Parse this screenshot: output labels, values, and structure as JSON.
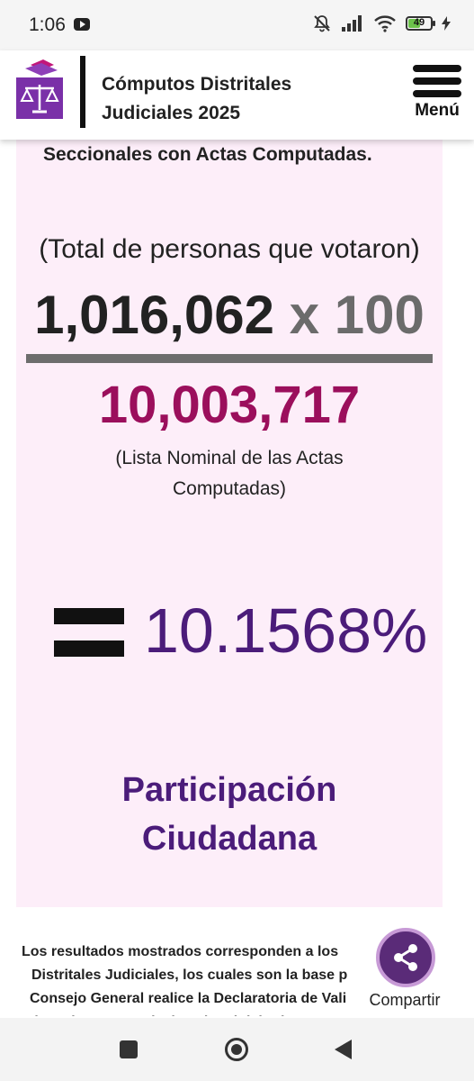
{
  "status_bar": {
    "time": "1:06",
    "battery_level": "49"
  },
  "header": {
    "title_line1": "Cómputos Distritales",
    "title_line2": "Judiciales 2025",
    "menu_label": "Menú"
  },
  "card": {
    "top_text": "Seccionales con Actas Computadas.",
    "total_label": "(Total de personas que votaron)",
    "numerator_value": "1,016,062",
    "multiplier": "x 100",
    "denominator_value": "10,003,717",
    "lista_label": "(Lista Nominal de las Actas Computadas)",
    "result_value": "10.1568%",
    "participacion_line1": "Participación",
    "participacion_line2": "Ciudadana"
  },
  "footer": {
    "line1": "Los resultados mostrados corresponden a los",
    "line2": "Distritales Judiciales, los cuales son la base p",
    "line3": "Consejo General realice la Declaratoria de Vali",
    "line4": "de cada cargo a nivel nacional del Cómputo Naci"
  },
  "share": {
    "label": "Compartir"
  },
  "colors": {
    "card_bg": "#fdeef9",
    "denominator": "#9b0f5c",
    "result": "#4b1c7a",
    "share_button": "#5a2b78"
  },
  "icons": {
    "logo": "ballot-box-scales-icon",
    "menu": "hamburger-menu-icon",
    "share": "share-icon"
  }
}
